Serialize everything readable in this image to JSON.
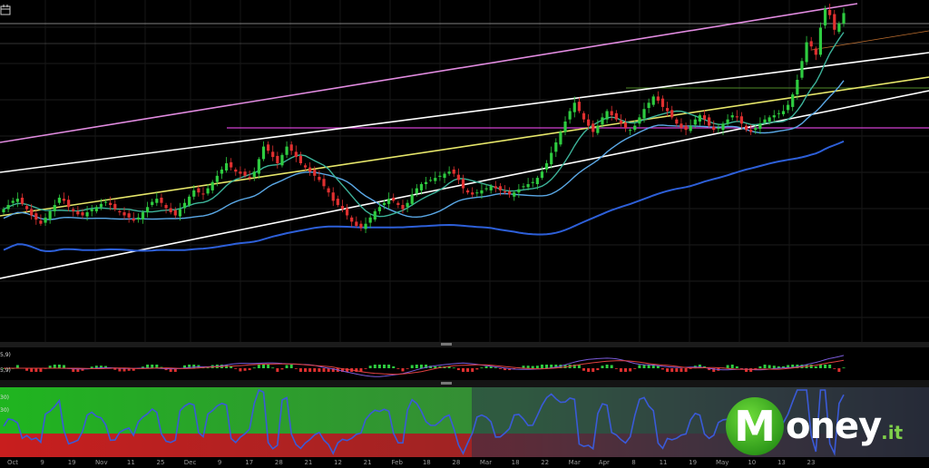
{
  "chart_data": [
    {
      "type": "candlestick",
      "series": [
        {
          "name": "",
          "color": "#2ecc40"
        },
        {
          "name": "",
          "color": "#e03030"
        }
      ],
      "closes": [
        36,
        40,
        44,
        46,
        41,
        36,
        30,
        26,
        22,
        28,
        34,
        40,
        47,
        44,
        38,
        34,
        31,
        30,
        33,
        36,
        38,
        41,
        43,
        40,
        36,
        33,
        30,
        28,
        25,
        28,
        33,
        38,
        43,
        46,
        42,
        37,
        33,
        30,
        36,
        42,
        48,
        54,
        52,
        50,
        56,
        62,
        68,
        74,
        80,
        76,
        72,
        70,
        68,
        66,
        72,
        84,
        96,
        92,
        86,
        80,
        88,
        96,
        92,
        86,
        80,
        76,
        72,
        68,
        64,
        58,
        52,
        44,
        40,
        36,
        30,
        24,
        20,
        18,
        22,
        28,
        34,
        38,
        42,
        46,
        44,
        40,
        36,
        42,
        50,
        56,
        60,
        62,
        64,
        66,
        68,
        70,
        72,
        70,
        64,
        56,
        52,
        50,
        52,
        54,
        56,
        58,
        56,
        54,
        52,
        50,
        52,
        55,
        58,
        60,
        62,
        66,
        72,
        80,
        90,
        100,
        110,
        120,
        130,
        138,
        130,
        122,
        116,
        110,
        116,
        124,
        130,
        126,
        122,
        118,
        114,
        112,
        116,
        124,
        132,
        138,
        144,
        140,
        134,
        130,
        124,
        118,
        114,
        112,
        116,
        122,
        126,
        122,
        116,
        112,
        114,
        118,
        122,
        126,
        124,
        118,
        112,
        110,
        114,
        118,
        122,
        124,
        126,
        128,
        130,
        136,
        146,
        160,
        178,
        196,
        192,
        184,
        210,
        228,
        222,
        208,
        214,
        224
      ],
      "moving_averages": [
        {
          "name": "",
          "color": "#5aa8e6"
        },
        {
          "name": "",
          "color": "#2d5fd8"
        },
        {
          "name": "",
          "color": "#3db39a"
        }
      ],
      "trend_lines": [
        {
          "name": "",
          "color": "#e18be0"
        },
        {
          "name": "",
          "color": "#ffffff"
        },
        {
          "name": "",
          "color": "#e6e66a"
        },
        {
          "name": "",
          "color": "#ffffff"
        }
      ],
      "horizontal_levels": [
        {
          "name": "",
          "color": "#d040d0"
        },
        {
          "name": "",
          "color": "#4f8a2a"
        }
      ],
      "x_tick_labels": [
        "Oct",
        "9",
        "19",
        "Nov",
        "11",
        "25",
        "Dec",
        "9",
        "17",
        "28",
        "21",
        "12",
        "21",
        "Feb",
        "18",
        "28",
        "Mar",
        "18",
        "22",
        "Mar",
        "Apr",
        "8",
        "11",
        "19",
        "May",
        "10",
        "13",
        "23"
      ]
    },
    {
      "type": "histogram",
      "panel_labels": [
        "5,9)",
        "5,9)"
      ],
      "series": [
        {
          "name": "",
          "color": "#2ecc40"
        },
        {
          "name": "",
          "color": "#e03030"
        }
      ],
      "line_colors": [
        "#7a5ad8",
        "#e04040"
      ]
    },
    {
      "type": "line",
      "panel_labels": [
        "30)",
        "30)"
      ],
      "series": [
        {
          "name": "",
          "color": "#3a5ad8"
        }
      ],
      "zone_colors": [
        "#2fae2f",
        "#c02a2a"
      ]
    }
  ],
  "logo": {
    "mark_letter": "M",
    "word_rest": "oney",
    "tld": ".it",
    "mark_color": "#3aa82a",
    "text_color": "#ffffff"
  },
  "toolbar": {
    "icon": "calendar-icon"
  }
}
